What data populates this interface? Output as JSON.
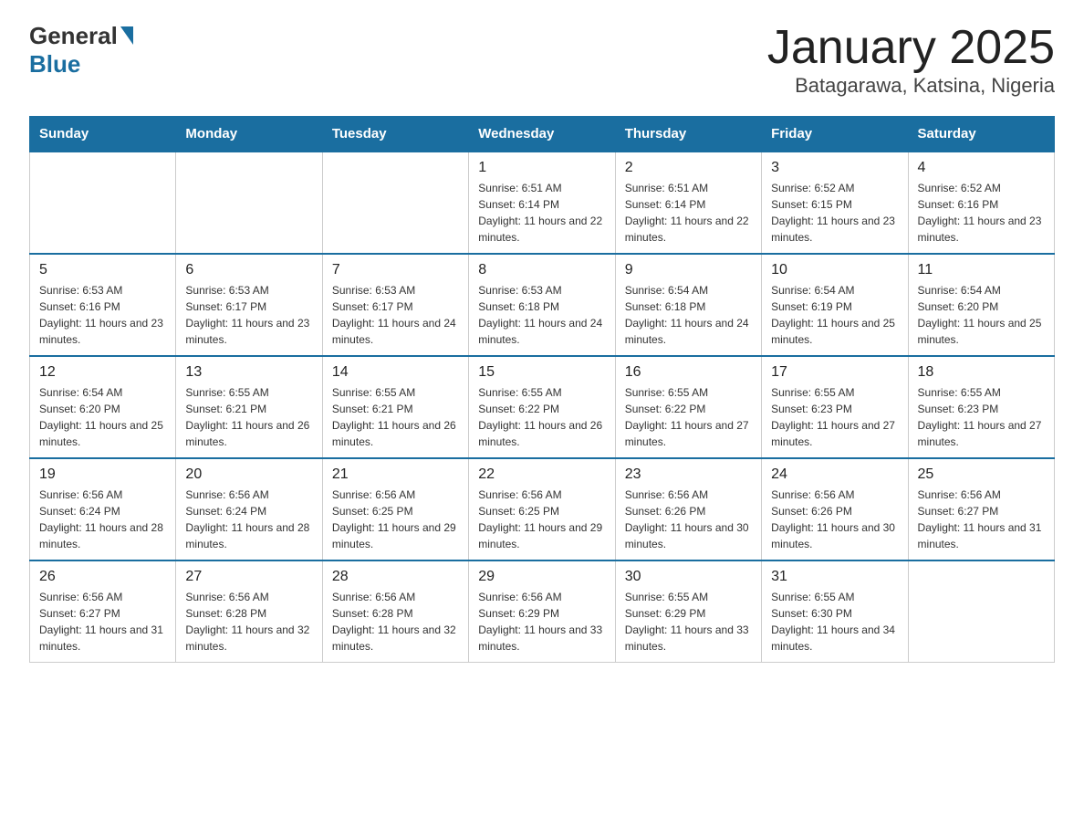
{
  "logo": {
    "general": "General",
    "blue": "Blue"
  },
  "title": "January 2025",
  "subtitle": "Batagarawa, Katsina, Nigeria",
  "days_of_week": [
    "Sunday",
    "Monday",
    "Tuesday",
    "Wednesday",
    "Thursday",
    "Friday",
    "Saturday"
  ],
  "weeks": [
    [
      {
        "day": "",
        "info": ""
      },
      {
        "day": "",
        "info": ""
      },
      {
        "day": "",
        "info": ""
      },
      {
        "day": "1",
        "info": "Sunrise: 6:51 AM\nSunset: 6:14 PM\nDaylight: 11 hours and 22 minutes."
      },
      {
        "day": "2",
        "info": "Sunrise: 6:51 AM\nSunset: 6:14 PM\nDaylight: 11 hours and 22 minutes."
      },
      {
        "day": "3",
        "info": "Sunrise: 6:52 AM\nSunset: 6:15 PM\nDaylight: 11 hours and 23 minutes."
      },
      {
        "day": "4",
        "info": "Sunrise: 6:52 AM\nSunset: 6:16 PM\nDaylight: 11 hours and 23 minutes."
      }
    ],
    [
      {
        "day": "5",
        "info": "Sunrise: 6:53 AM\nSunset: 6:16 PM\nDaylight: 11 hours and 23 minutes."
      },
      {
        "day": "6",
        "info": "Sunrise: 6:53 AM\nSunset: 6:17 PM\nDaylight: 11 hours and 23 minutes."
      },
      {
        "day": "7",
        "info": "Sunrise: 6:53 AM\nSunset: 6:17 PM\nDaylight: 11 hours and 24 minutes."
      },
      {
        "day": "8",
        "info": "Sunrise: 6:53 AM\nSunset: 6:18 PM\nDaylight: 11 hours and 24 minutes."
      },
      {
        "day": "9",
        "info": "Sunrise: 6:54 AM\nSunset: 6:18 PM\nDaylight: 11 hours and 24 minutes."
      },
      {
        "day": "10",
        "info": "Sunrise: 6:54 AM\nSunset: 6:19 PM\nDaylight: 11 hours and 25 minutes."
      },
      {
        "day": "11",
        "info": "Sunrise: 6:54 AM\nSunset: 6:20 PM\nDaylight: 11 hours and 25 minutes."
      }
    ],
    [
      {
        "day": "12",
        "info": "Sunrise: 6:54 AM\nSunset: 6:20 PM\nDaylight: 11 hours and 25 minutes."
      },
      {
        "day": "13",
        "info": "Sunrise: 6:55 AM\nSunset: 6:21 PM\nDaylight: 11 hours and 26 minutes."
      },
      {
        "day": "14",
        "info": "Sunrise: 6:55 AM\nSunset: 6:21 PM\nDaylight: 11 hours and 26 minutes."
      },
      {
        "day": "15",
        "info": "Sunrise: 6:55 AM\nSunset: 6:22 PM\nDaylight: 11 hours and 26 minutes."
      },
      {
        "day": "16",
        "info": "Sunrise: 6:55 AM\nSunset: 6:22 PM\nDaylight: 11 hours and 27 minutes."
      },
      {
        "day": "17",
        "info": "Sunrise: 6:55 AM\nSunset: 6:23 PM\nDaylight: 11 hours and 27 minutes."
      },
      {
        "day": "18",
        "info": "Sunrise: 6:55 AM\nSunset: 6:23 PM\nDaylight: 11 hours and 27 minutes."
      }
    ],
    [
      {
        "day": "19",
        "info": "Sunrise: 6:56 AM\nSunset: 6:24 PM\nDaylight: 11 hours and 28 minutes."
      },
      {
        "day": "20",
        "info": "Sunrise: 6:56 AM\nSunset: 6:24 PM\nDaylight: 11 hours and 28 minutes."
      },
      {
        "day": "21",
        "info": "Sunrise: 6:56 AM\nSunset: 6:25 PM\nDaylight: 11 hours and 29 minutes."
      },
      {
        "day": "22",
        "info": "Sunrise: 6:56 AM\nSunset: 6:25 PM\nDaylight: 11 hours and 29 minutes."
      },
      {
        "day": "23",
        "info": "Sunrise: 6:56 AM\nSunset: 6:26 PM\nDaylight: 11 hours and 30 minutes."
      },
      {
        "day": "24",
        "info": "Sunrise: 6:56 AM\nSunset: 6:26 PM\nDaylight: 11 hours and 30 minutes."
      },
      {
        "day": "25",
        "info": "Sunrise: 6:56 AM\nSunset: 6:27 PM\nDaylight: 11 hours and 31 minutes."
      }
    ],
    [
      {
        "day": "26",
        "info": "Sunrise: 6:56 AM\nSunset: 6:27 PM\nDaylight: 11 hours and 31 minutes."
      },
      {
        "day": "27",
        "info": "Sunrise: 6:56 AM\nSunset: 6:28 PM\nDaylight: 11 hours and 32 minutes."
      },
      {
        "day": "28",
        "info": "Sunrise: 6:56 AM\nSunset: 6:28 PM\nDaylight: 11 hours and 32 minutes."
      },
      {
        "day": "29",
        "info": "Sunrise: 6:56 AM\nSunset: 6:29 PM\nDaylight: 11 hours and 33 minutes."
      },
      {
        "day": "30",
        "info": "Sunrise: 6:55 AM\nSunset: 6:29 PM\nDaylight: 11 hours and 33 minutes."
      },
      {
        "day": "31",
        "info": "Sunrise: 6:55 AM\nSunset: 6:30 PM\nDaylight: 11 hours and 34 minutes."
      },
      {
        "day": "",
        "info": ""
      }
    ]
  ]
}
